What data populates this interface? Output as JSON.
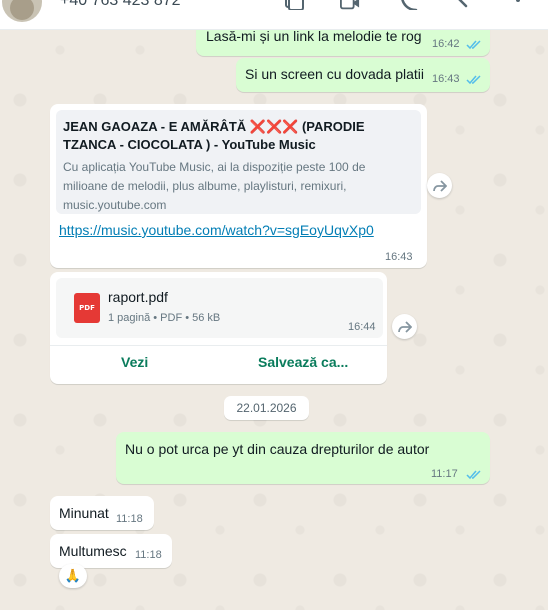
{
  "header": {
    "contact_name": "+40 763 423 872",
    "icons": [
      "gallery-icon",
      "video-call-icon",
      "voice-call-icon",
      "search-icon",
      "more-options-icon"
    ]
  },
  "messages": {
    "out1": {
      "text": "Lasă-mi și un link la melodie te rog",
      "time": "16:42",
      "status": "read"
    },
    "out2": {
      "text": "Si un screen cu dovada platii",
      "time": "16:43",
      "status": "read"
    },
    "link_msg": {
      "preview_title": "JEAN GAOAZA - E AMĂRÂTĂ ❌❌❌ (PARODIE TZANCA - CIOCOLATA ) - YouTube Music",
      "preview_desc": "Cu aplicația YouTube Music, ai la dispoziție peste 100 de milioane de melodii, plus albume, playlisturi, remixuri,",
      "preview_domain": "music.youtube.com",
      "url": "https://music.youtube.com/watch?v=sgEoyUqvXp0",
      "time": "16:43"
    },
    "doc_msg": {
      "file_name": "raport.pdf",
      "file_meta": "1 pagină • PDF • 56 kB",
      "file_type_label": "PDF",
      "time": "16:44",
      "view_label": "Vezi",
      "save_label": "Salvează ca..."
    },
    "date_separator": "22.01.2026",
    "out3": {
      "text": "Nu o pot urca pe yt din cauza drepturilor de autor",
      "time": "11:17",
      "status": "read"
    },
    "in1": {
      "text": "Minunat",
      "time": "11:18"
    },
    "in2": {
      "text": "Multumesc",
      "time": "11:18",
      "reaction": "🙏"
    }
  },
  "colors": {
    "outgoing_bubble": "#d9fdd3",
    "incoming_bubble": "#ffffff",
    "read_ticks": "#53bdeb",
    "link": "#027eb5",
    "doc_action": "#0a7c5c",
    "pdf_icon": "#e53935"
  }
}
